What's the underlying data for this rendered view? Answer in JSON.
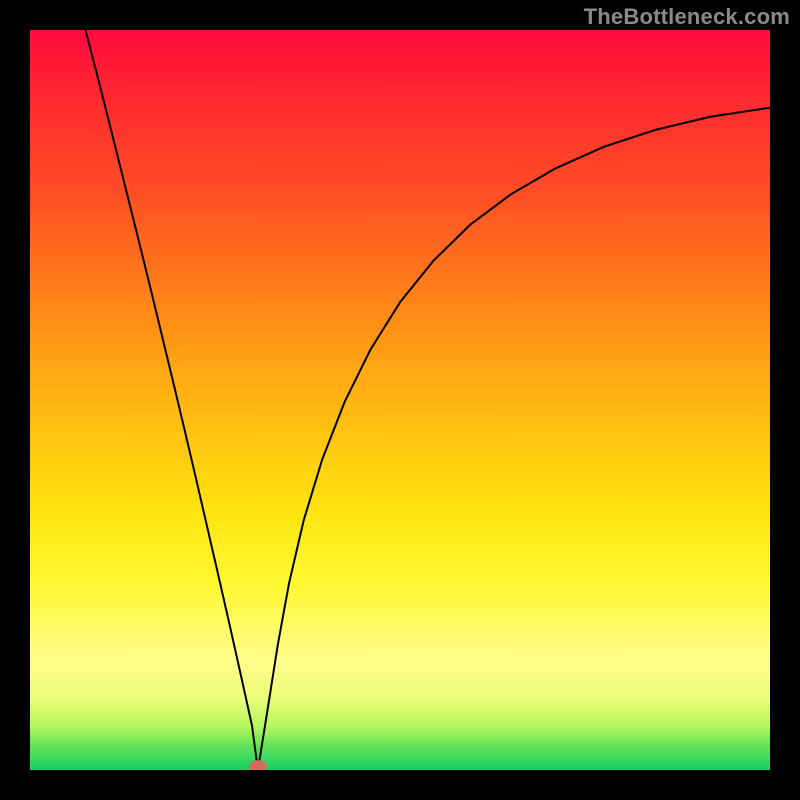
{
  "watermark": {
    "text": "TheBottleneck.com"
  },
  "marker": {
    "color": "#d86b5f",
    "rx": 9,
    "ry": 6,
    "cx_frac": 0.308,
    "cy_frac": 0.995
  },
  "chart_data": {
    "type": "line",
    "title": "",
    "xlabel": "",
    "ylabel": "",
    "xlim": [
      0,
      1
    ],
    "ylim": [
      0,
      1
    ],
    "grid": false,
    "legend": false,
    "annotations": [],
    "background_gradient": {
      "direction": "vertical",
      "stops": [
        {
          "pos": 0.0,
          "color": "#ff0b3c"
        },
        {
          "pos": 0.1,
          "color": "#ff2b2f"
        },
        {
          "pos": 0.22,
          "color": "#ff4e25"
        },
        {
          "pos": 0.34,
          "color": "#ff7a1a"
        },
        {
          "pos": 0.44,
          "color": "#ffa014"
        },
        {
          "pos": 0.55,
          "color": "#ffc510"
        },
        {
          "pos": 0.65,
          "color": "#ffe410"
        },
        {
          "pos": 0.75,
          "color": "#fff933"
        },
        {
          "pos": 0.85,
          "color": "#fffd8a"
        },
        {
          "pos": 0.9,
          "color": "#eefc7b"
        },
        {
          "pos": 0.94,
          "color": "#b7f85e"
        },
        {
          "pos": 0.97,
          "color": "#5de057"
        },
        {
          "pos": 1.0,
          "color": "#17cf67"
        }
      ]
    },
    "series": [
      {
        "name": "bottleneck-curve",
        "color": "#000000",
        "stroke_width": 2,
        "x": [
          0.075,
          0.09,
          0.105,
          0.12,
          0.135,
          0.15,
          0.165,
          0.18,
          0.195,
          0.21,
          0.225,
          0.24,
          0.255,
          0.27,
          0.285,
          0.3,
          0.308,
          0.32,
          0.335,
          0.35,
          0.37,
          0.395,
          0.425,
          0.46,
          0.5,
          0.545,
          0.595,
          0.65,
          0.71,
          0.775,
          0.845,
          0.92,
          1.0
        ],
        "y": [
          1.0,
          0.942,
          0.883,
          0.823,
          0.763,
          0.703,
          0.642,
          0.58,
          0.518,
          0.455,
          0.391,
          0.326,
          0.261,
          0.195,
          0.128,
          0.06,
          0.0,
          0.075,
          0.17,
          0.252,
          0.338,
          0.42,
          0.497,
          0.568,
          0.632,
          0.688,
          0.737,
          0.778,
          0.813,
          0.842,
          0.865,
          0.883,
          0.895
        ]
      }
    ],
    "marker": {
      "x": 0.308,
      "y": 0.005,
      "color": "#d86b5f"
    }
  }
}
